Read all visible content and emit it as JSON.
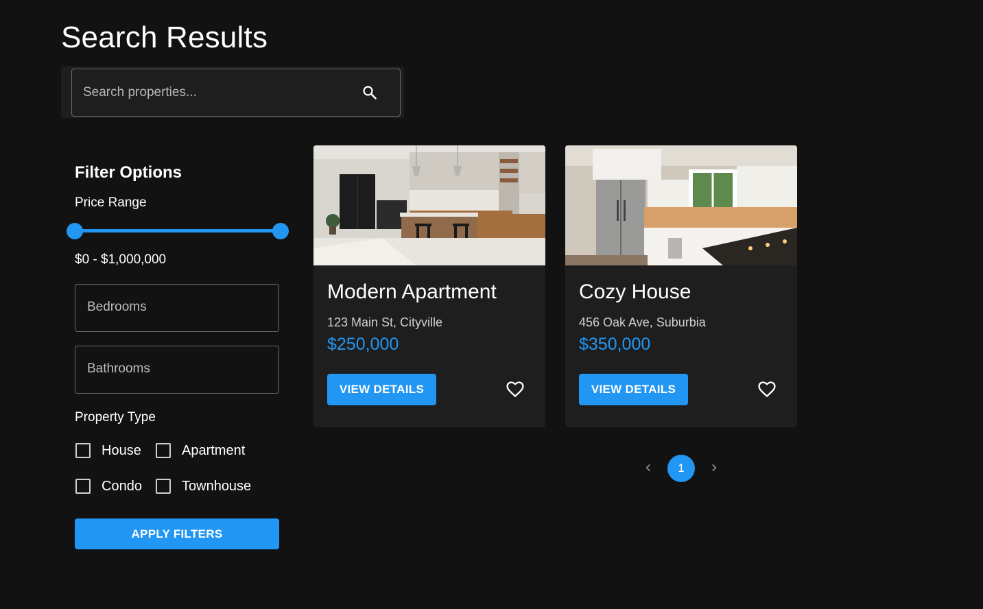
{
  "page": {
    "title": "Search Results"
  },
  "search": {
    "placeholder": "Search properties...",
    "icon": "search-icon"
  },
  "filters": {
    "title": "Filter Options",
    "price_label": "Price Range",
    "price_range": {
      "min": 0,
      "max": 1000000,
      "value_min_fraction": 0,
      "value_max_fraction": 1
    },
    "price_text": "$0 - $1,000,000",
    "bedrooms_label": "Bedrooms",
    "bathrooms_label": "Bathrooms",
    "property_type_label": "Property Type",
    "property_types": [
      {
        "label": "House",
        "checked": false
      },
      {
        "label": "Apartment",
        "checked": false
      },
      {
        "label": "Condo",
        "checked": false
      },
      {
        "label": "Townhouse",
        "checked": false
      }
    ],
    "apply_label": "APPLY FILTERS"
  },
  "listings": [
    {
      "title": "Modern Apartment",
      "address": "123 Main St, Cityville",
      "price": "$250,000",
      "button_label": "VIEW DETAILS",
      "favorite_icon": "heart-outline-icon"
    },
    {
      "title": "Cozy House",
      "address": "456 Oak Ave, Suburbia",
      "price": "$350,000",
      "button_label": "VIEW DETAILS",
      "favorite_icon": "heart-outline-icon"
    }
  ],
  "pagination": {
    "current_page": "1"
  },
  "colors": {
    "background": "#121212",
    "surface": "#1e1e1e",
    "accent": "#2196f3"
  }
}
